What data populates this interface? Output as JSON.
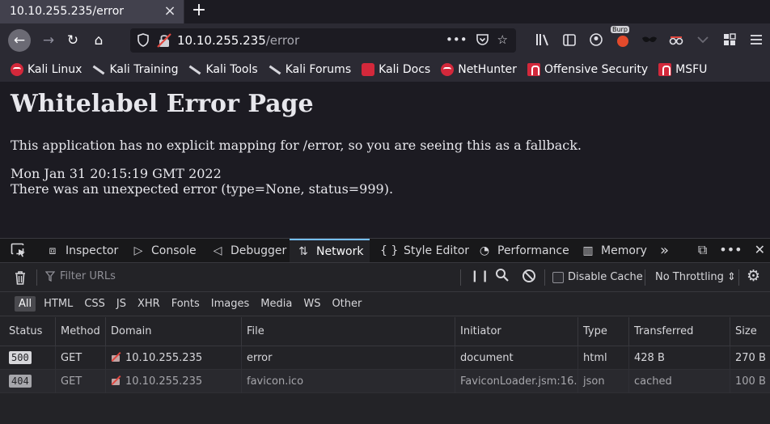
{
  "tab": {
    "title": "10.10.255.235/error",
    "close": "×",
    "new_tab": "+"
  },
  "nav": {
    "back_icon": "←",
    "forward_icon": "→",
    "reload_icon": "↻",
    "home_icon": "⌂",
    "url_host": "10.10.255.235",
    "url_path": "/error",
    "url_actions": [
      "•••",
      "☐",
      "☆"
    ],
    "toolbar_icons": [
      "library-icon",
      "sidebar-icon",
      "account-icon",
      "burp-icon",
      "mask-icon",
      "spy-icon",
      "chevron-icon",
      "extensions-icon",
      "menu-icon"
    ],
    "burp_label": "Burp"
  },
  "bookmarks": [
    {
      "label": "Kali Linux",
      "icon": "kali"
    },
    {
      "label": "Kali Training",
      "icon": "dragon"
    },
    {
      "label": "Kali Tools",
      "icon": "dragon"
    },
    {
      "label": "Kali Forums",
      "icon": "dragon"
    },
    {
      "label": "Kali Docs",
      "icon": "docs"
    },
    {
      "label": "NetHunter",
      "icon": "kali"
    },
    {
      "label": "Offensive Security",
      "icon": "offsec"
    },
    {
      "label": "MSFU",
      "icon": "offsec"
    }
  ],
  "page": {
    "heading": "Whitelabel Error Page",
    "message": "This application has no explicit mapping for /error, so you are seeing this as a fallback.",
    "timestamp": "Mon Jan 31 20:15:19 GMT 2022",
    "error_detail": "There was an unexpected error (type=None, status=999)."
  },
  "devtools": {
    "tabs": [
      {
        "label": "Inspector",
        "icon": "⧈"
      },
      {
        "label": "Console",
        "icon": "▷"
      },
      {
        "label": "Debugger",
        "icon": "◁"
      },
      {
        "label": "Network",
        "icon": "⇅",
        "selected": true
      },
      {
        "label": "Style Editor",
        "icon": "{ }"
      },
      {
        "label": "Performance",
        "icon": "◔"
      },
      {
        "label": "Memory",
        "icon": "▥"
      }
    ],
    "more_tabs": "»",
    "right_icons": [
      "⧉",
      "•••",
      "✕"
    ],
    "filter_placeholder": "Filter URLs",
    "pause_label": "❙❙",
    "search_icon": "⚲",
    "disable_cache_label": "Disable Cache",
    "throttling_label": "No Throttling ⇕",
    "settings_icon": "⚙",
    "type_filters": [
      "All",
      "HTML",
      "CSS",
      "JS",
      "XHR",
      "Fonts",
      "Images",
      "Media",
      "WS",
      "Other"
    ],
    "columns": [
      "Status",
      "Method",
      "Domain",
      "File",
      "Initiator",
      "Type",
      "Transferred",
      "Size"
    ],
    "rows": [
      {
        "status": "500",
        "method": "GET",
        "domain": "10.10.255.235",
        "file": "error",
        "initiator": "document",
        "type": "html",
        "transferred": "428 B",
        "size": "270 B"
      },
      {
        "status": "404",
        "method": "GET",
        "domain": "10.10.255.235",
        "file": "favicon.ico",
        "initiator": "FaviconLoader.jsm:16...",
        "type": "json",
        "transferred": "cached",
        "size": "100 B"
      }
    ]
  },
  "colors": {
    "accent": "#75bfff",
    "kali_red": "#d3283b",
    "page_bg": "#1c1b22",
    "devtools_bg": "#232327"
  }
}
